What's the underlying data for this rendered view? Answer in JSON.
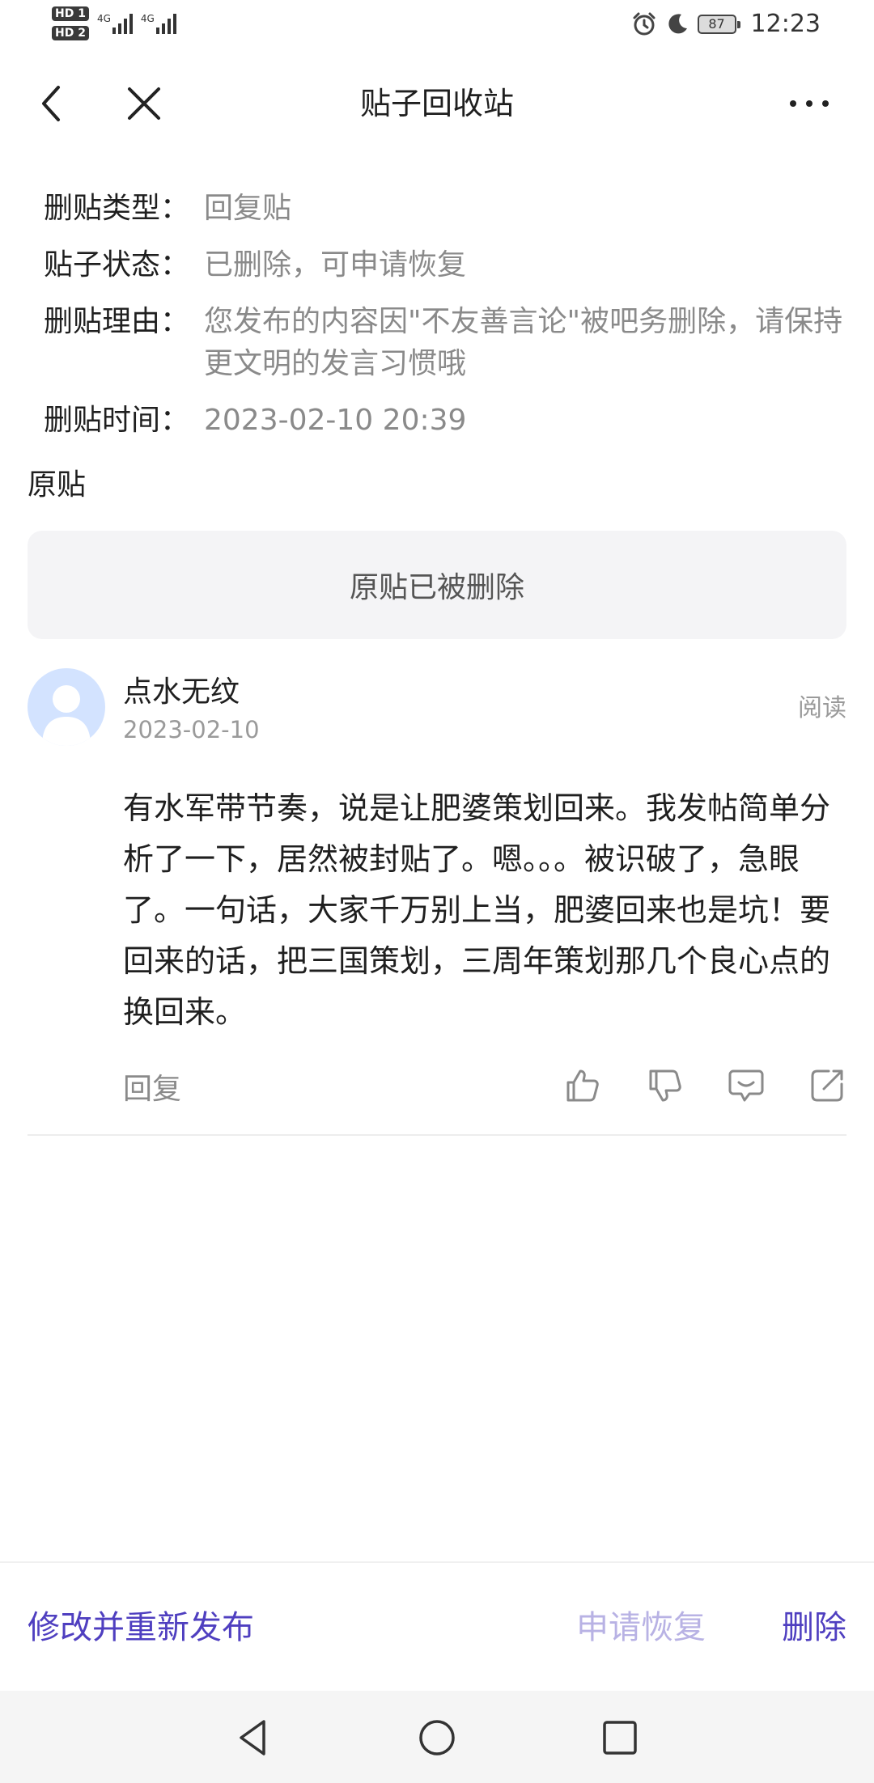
{
  "status_bar": {
    "sim1_badge": "HD 1",
    "sim2_badge": "HD 2",
    "network1": "4G",
    "network2": "4G",
    "battery": "87",
    "time": "12:23"
  },
  "nav": {
    "title": "贴子回收站"
  },
  "info": {
    "type_label": "删贴类型：",
    "type_value": "回复贴",
    "status_label": "贴子状态：",
    "status_value": "已删除，可申请恢复",
    "reason_label": "删贴理由：",
    "reason_value": "您发布的内容因\"不友善言论\"被吧务删除，请保持更文明的发言习惯哦",
    "time_label": "删贴时间：",
    "time_value": "2023-02-10 20:39"
  },
  "original": {
    "label": "原贴",
    "deleted_notice": "原贴已被删除"
  },
  "post": {
    "username": "点水无纹",
    "date": "2023-02-10",
    "read_label": "阅读",
    "content": " 有水军带节奏，说是让肥婆策划回来。我发帖简单分析了一下，居然被封贴了。嗯。。。被识破了，急眼了。一句话，大家千万别上当，肥婆回来也是坑！要回来的话，把三国策划，三周年策划那几个良心点的换回来。",
    "reply_label": "回复"
  },
  "bottom_actions": {
    "edit_label": "修改并重新发布",
    "restore_label": "申请恢复",
    "delete_label": "删除"
  },
  "colors": {
    "accent": "#4f3fc0",
    "accent_disabled": "#b8b2e4",
    "muted_text": "#8a8a8a",
    "box_bg": "#f4f4f6"
  },
  "icons": {
    "back": "chevron-left-icon",
    "close": "close-icon",
    "more": "more-dots-icon",
    "like": "thumbs-up-icon",
    "dislike": "thumbs-down-icon",
    "comment": "comment-icon",
    "share": "share-icon",
    "alarm": "alarm-icon",
    "moon": "moon-icon"
  }
}
